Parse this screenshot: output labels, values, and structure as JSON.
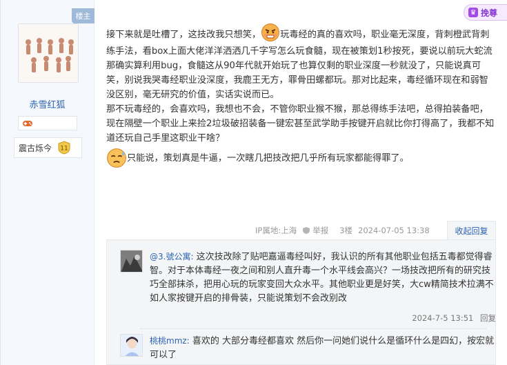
{
  "author": {
    "badge": "楼主",
    "name": "赤雪红狐",
    "level_label": "震古烁今",
    "level_number": "11"
  },
  "promo": {
    "label": "挽尊"
  },
  "post": {
    "para1_a": "接下来就是吐槽了，这技改我只想笑，",
    "para1_b": "玩毒经的真的喜欢吗，职业毫无深度，背刺橙武背刺练手法，看box上面大佬洋洋洒洒几千字写怎么玩食髓，现在被策划1秒按死，要说以前玩大蛇流那确实算利用bug，食髓这从90年代就开始玩了也算仅剩的职业深度一秒就没了，只能说真可笑，别说我哭毒经职业没深度，我鹿王无方，罪骨田螺都玩。那对比起来，毒经循环现在和弱智没区别，毫无研究的价值，实话实说而已。",
    "para2": "那不玩毒经的，会喜欢吗，我想也不会，不管你职业猴不猴，那总得练手法吧，总得拍装备吧，现在隔壁一个职业上来捡2垃圾破招装备一键宏甚至武学助手按键开启就比你打得高了，我都不知道还玩自己手里这职业干啥？",
    "para3": "只能说，策划真是牛逼，一次瞎几把技改把几乎所有玩家都能得罪了。"
  },
  "tail": {
    "ip": "IP属地:上海",
    "report": "举报",
    "floor": "3楼",
    "time": "2024-07-05 13:38",
    "reply_toggle": "收起回复"
  },
  "replies": [
    {
      "user": "@3.號公寓:",
      "text": "这次技改除了贴吧嘉逼毒经叫好，我认识的所有其他职业包括五毒都觉得睿智。对于本体毒经一夜之间和别人直升毒一个水平线会高兴？一场技改把所有的研究技巧全部抹杀，把用心玩的玩家变回大众水平。其他职业更是好笑，大cw精简技术拉满不如人家按键开启的排骨装，只能说策划不会改别改",
      "time": "2024-7-5 13:51",
      "reply": "回复"
    },
    {
      "user": "桃桃mmz:",
      "text": "喜欢的 大部分毒经都喜欢 然后你一问她们说什么是循环什么是四幻，按宏就可以了"
    }
  ],
  "icons": {
    "game_icon": "gamepad-icon",
    "level_icon": "level-badge-icon",
    "angry_emoji": "angry-face-emoji",
    "sweat_emoji": "sweat-face-emoji",
    "report_icon": "shield-report-icon"
  },
  "colors": {
    "link": "#2d64b3",
    "badge_bg": "#9fb9d8",
    "meta": "#999999"
  }
}
